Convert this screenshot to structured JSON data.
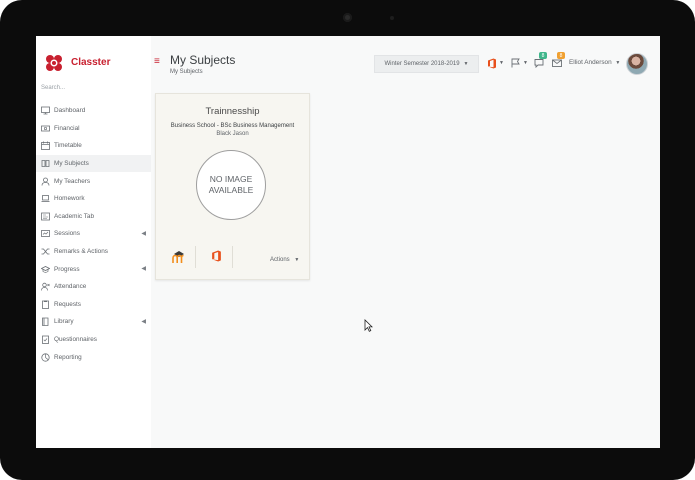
{
  "app": {
    "brand": "Classter",
    "search_placeholder": "Search..."
  },
  "sidebar": {
    "items": [
      {
        "label": "Dashboard",
        "icon": "monitor-icon",
        "active": false,
        "has_submenu": false
      },
      {
        "label": "Financial",
        "icon": "money-icon",
        "active": false,
        "has_submenu": false
      },
      {
        "label": "Timetable",
        "icon": "calendar-icon",
        "active": false,
        "has_submenu": false
      },
      {
        "label": "My Subjects",
        "icon": "book-icon",
        "active": true,
        "has_submenu": false
      },
      {
        "label": "My Teachers",
        "icon": "user-icon",
        "active": false,
        "has_submenu": false
      },
      {
        "label": "Homework",
        "icon": "laptop-icon",
        "active": false,
        "has_submenu": false
      },
      {
        "label": "Academic Tab",
        "icon": "grades-icon",
        "active": false,
        "has_submenu": false
      },
      {
        "label": "Sessions",
        "icon": "sessions-icon",
        "active": false,
        "has_submenu": true
      },
      {
        "label": "Remarks & Actions",
        "icon": "shuffle-icon",
        "active": false,
        "has_submenu": false
      },
      {
        "label": "Progress",
        "icon": "graduation-icon",
        "active": false,
        "has_submenu": true
      },
      {
        "label": "Attendance",
        "icon": "user-x-icon",
        "active": false,
        "has_submenu": false
      },
      {
        "label": "Requests",
        "icon": "clipboard-icon",
        "active": false,
        "has_submenu": false
      },
      {
        "label": "Library",
        "icon": "library-icon",
        "active": false,
        "has_submenu": true
      },
      {
        "label": "Questionnaires",
        "icon": "checklist-icon",
        "active": false,
        "has_submenu": false
      },
      {
        "label": "Reporting",
        "icon": "chart-icon",
        "active": false,
        "has_submenu": false
      }
    ]
  },
  "header": {
    "title": "My Subjects",
    "breadcrumb": "My Subjects",
    "semester": "Winter Semester 2018-2019",
    "messages_badge": "8",
    "notifications_badge": "8",
    "user_name": "Elliot Anderson"
  },
  "card": {
    "title": "Trainnesship",
    "subtitle": "Business School - BSc Business Management",
    "teacher": "Black Jason",
    "no_image_line1": "NO IMAGE",
    "no_image_line2": "AVAILABLE",
    "actions_label": "Actions"
  },
  "colors": {
    "brand": "#c8202f",
    "office": "#e8501c",
    "badge_green": "#3fb68b",
    "badge_orange": "#f0a030",
    "moodle": "#f28e1c"
  }
}
